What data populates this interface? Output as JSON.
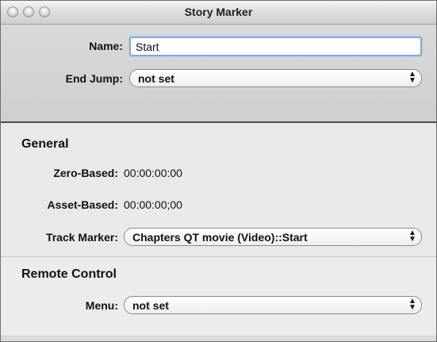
{
  "window": {
    "title": "Story Marker"
  },
  "name_field": {
    "label": "Name:",
    "value": "Start"
  },
  "end_jump": {
    "label": "End Jump:",
    "selected": "not set"
  },
  "general": {
    "heading": "General",
    "zero_based": {
      "label": "Zero-Based:",
      "value": "00:00:00:00"
    },
    "asset_based": {
      "label": "Asset-Based:",
      "value": "00:00:00;00"
    },
    "track_marker": {
      "label": "Track Marker:",
      "selected": "Chapters QT movie (Video)::Start"
    }
  },
  "remote_control": {
    "heading": "Remote Control",
    "menu": {
      "label": "Menu:",
      "selected": "not set"
    }
  },
  "icons": {
    "popup_arrows": "updown-arrows-icon"
  }
}
